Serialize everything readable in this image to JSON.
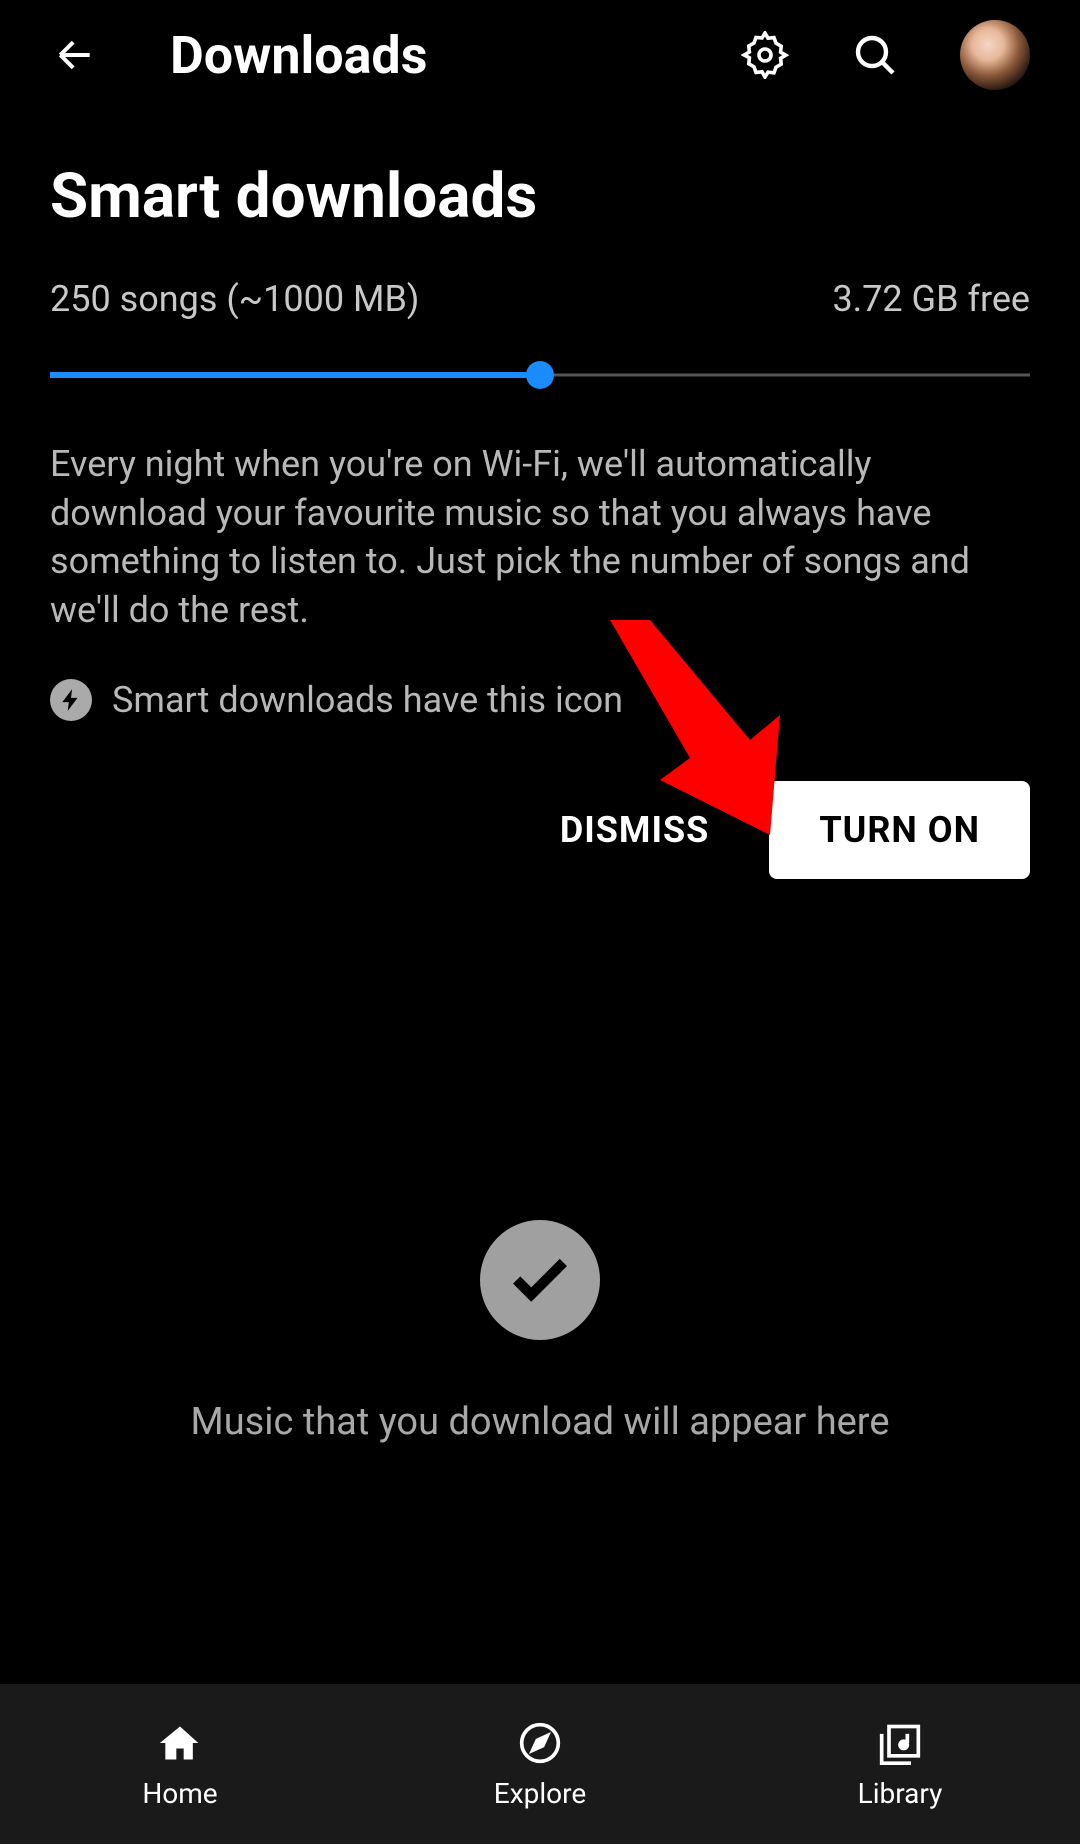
{
  "header": {
    "title": "Downloads"
  },
  "section": {
    "title": "Smart downloads",
    "songs_label": "250 songs (~1000 MB)",
    "free_label": "3.72 GB free",
    "slider_percent": 50,
    "description": "Every night when you're on Wi-Fi, we'll automatically download your favourite music so that you always have something to listen to. Just pick the number of songs and we'll do the rest.",
    "icon_note": "Smart downloads have this icon",
    "dismiss_label": "DISMISS",
    "turnon_label": "TURN ON"
  },
  "empty_state": {
    "text": "Music that you download will appear here"
  },
  "nav": {
    "items": [
      {
        "label": "Home"
      },
      {
        "label": "Explore"
      },
      {
        "label": "Library"
      }
    ]
  },
  "colors": {
    "accent": "#1a8cff",
    "annotation": "#ff0000"
  }
}
